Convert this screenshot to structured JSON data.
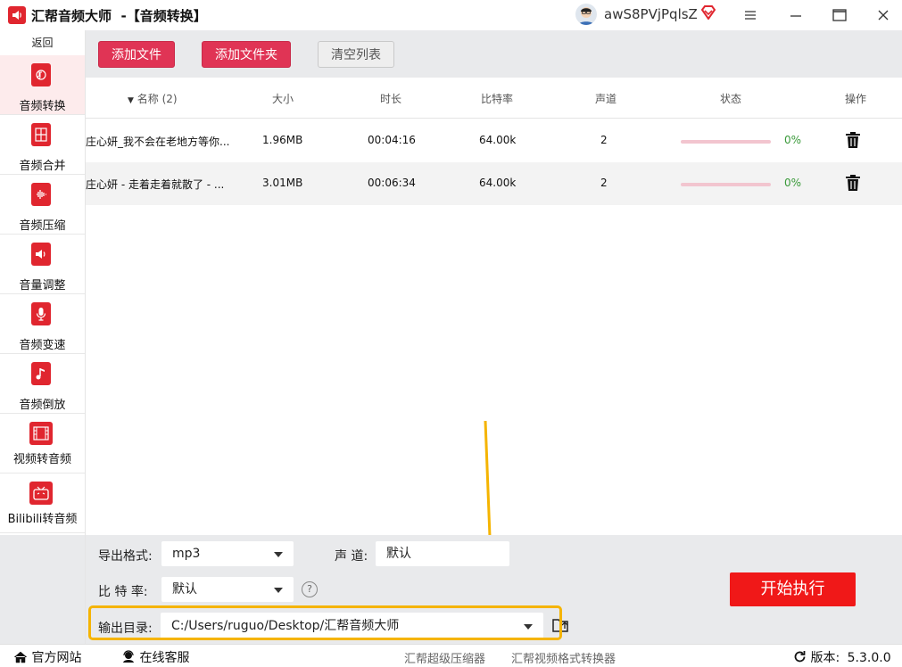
{
  "app": {
    "title": "汇帮音频大师",
    "module_title": "-【音频转换】",
    "username": "awS8PVjPqlsZ",
    "accent_color": "#e0262f"
  },
  "sidebar": {
    "back_label": "返回",
    "items": [
      {
        "label": "音频转换",
        "icon": "audio-convert-icon",
        "active": true
      },
      {
        "label": "音频合并",
        "icon": "audio-merge-icon",
        "active": false
      },
      {
        "label": "音频压缩",
        "icon": "audio-compress-icon",
        "active": false
      },
      {
        "label": "音量调整",
        "icon": "volume-icon",
        "active": false
      },
      {
        "label": "音频变速",
        "icon": "microphone-icon",
        "active": false
      },
      {
        "label": "音频倒放",
        "icon": "music-note-icon",
        "active": false
      },
      {
        "label": "视频转音频",
        "icon": "film-icon",
        "active": false
      },
      {
        "label": "Bilibili转音频",
        "icon": "tv-icon",
        "active": false
      }
    ]
  },
  "toolbar": {
    "add_file_label": "添加文件",
    "add_folder_label": "添加文件夹",
    "clear_list_label": "清空列表"
  },
  "table": {
    "headers": {
      "name": "名称 (2)",
      "size": "大小",
      "duration": "时长",
      "bitrate": "比特率",
      "channels": "声道",
      "status": "状态",
      "action": "操作"
    },
    "rows": [
      {
        "name": "庄心妍_我不会在老地方等你...",
        "size": "1.96MB",
        "duration": "00:04:16",
        "bitrate": "64.00k",
        "channels": "2",
        "progress": 0,
        "progress_label": "0%"
      },
      {
        "name": "庄心妍 - 走着走着就散了 - ...",
        "size": "3.01MB",
        "duration": "00:06:34",
        "bitrate": "64.00k",
        "channels": "2",
        "progress": 0,
        "progress_label": "0%"
      }
    ]
  },
  "settings": {
    "format_label": "导出格式:",
    "format_value": "mp3",
    "channel_label": "声 道:",
    "channel_value": "默认",
    "bitrate_label": "比 特 率:",
    "bitrate_value": "默认",
    "help_glyph": "?",
    "output_label": "输出目录:",
    "output_value": "C:/Users/ruguo/Desktop/汇帮音频大师",
    "start_label": "开始执行"
  },
  "statusbar": {
    "website_label": "官方网站",
    "support_label": "在线客服",
    "link1_label": "汇帮超级压缩器",
    "link2_label": "汇帮视频格式转换器",
    "version_label": "版本:",
    "version_value": "5.3.0.0"
  }
}
